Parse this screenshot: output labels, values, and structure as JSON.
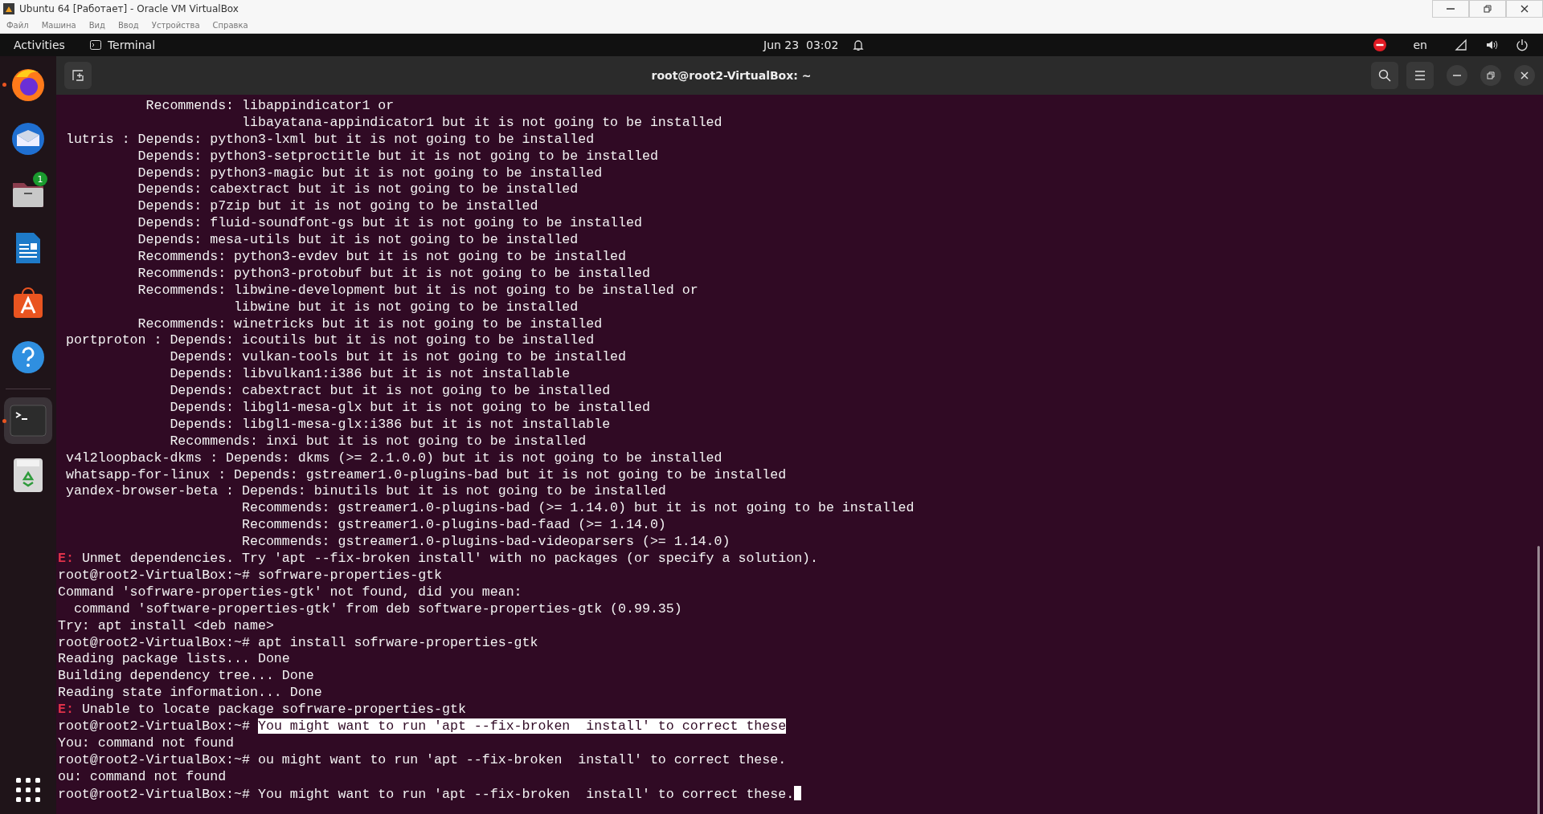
{
  "host_window": {
    "title": "Ubuntu 64 [Работает] - Oracle VM VirtualBox",
    "menu": [
      "Файл",
      "Машина",
      "Вид",
      "Ввод",
      "Устройства",
      "Справка"
    ]
  },
  "top_bar": {
    "activities": "Activities",
    "app": "Terminal",
    "clock": "Jun 23  03:02",
    "keyboard_layout": "en"
  },
  "dock": [
    {
      "kind": "firefox",
      "running": true,
      "selected": false
    },
    {
      "kind": "mail",
      "running": false,
      "selected": false
    },
    {
      "kind": "files",
      "running": false,
      "selected": false,
      "badge": "1"
    },
    {
      "kind": "writer",
      "running": false,
      "selected": false
    },
    {
      "kind": "store",
      "running": false,
      "selected": false
    },
    {
      "kind": "help",
      "running": false,
      "selected": false
    },
    {
      "kind": "terminal",
      "running": true,
      "selected": true
    },
    {
      "kind": "trash",
      "running": false,
      "selected": false
    }
  ],
  "terminal": {
    "title": "root@root2-VirtualBox: ~",
    "lines": [
      {
        "kind": "plain",
        "text": "           Recommends: libappindicator1 or"
      },
      {
        "kind": "plain",
        "text": "                       libayatana-appindicator1 but it is not going to be installed"
      },
      {
        "kind": "plain",
        "text": " lutris : Depends: python3-lxml but it is not going to be installed"
      },
      {
        "kind": "plain",
        "text": "          Depends: python3-setproctitle but it is not going to be installed"
      },
      {
        "kind": "plain",
        "text": "          Depends: python3-magic but it is not going to be installed"
      },
      {
        "kind": "plain",
        "text": "          Depends: cabextract but it is not going to be installed"
      },
      {
        "kind": "plain",
        "text": "          Depends: p7zip but it is not going to be installed"
      },
      {
        "kind": "plain",
        "text": "          Depends: fluid-soundfont-gs but it is not going to be installed"
      },
      {
        "kind": "plain",
        "text": "          Depends: mesa-utils but it is not going to be installed"
      },
      {
        "kind": "plain",
        "text": "          Recommends: python3-evdev but it is not going to be installed"
      },
      {
        "kind": "plain",
        "text": "          Recommends: python3-protobuf but it is not going to be installed"
      },
      {
        "kind": "plain",
        "text": "          Recommends: libwine-development but it is not going to be installed or"
      },
      {
        "kind": "plain",
        "text": "                      libwine but it is not going to be installed"
      },
      {
        "kind": "plain",
        "text": "          Recommends: winetricks but it is not going to be installed"
      },
      {
        "kind": "plain",
        "text": " portproton : Depends: icoutils but it is not going to be installed"
      },
      {
        "kind": "plain",
        "text": "              Depends: vulkan-tools but it is not going to be installed"
      },
      {
        "kind": "plain",
        "text": "              Depends: libvulkan1:i386 but it is not installable"
      },
      {
        "kind": "plain",
        "text": "              Depends: cabextract but it is not going to be installed"
      },
      {
        "kind": "plain",
        "text": "              Depends: libgl1-mesa-glx but it is not going to be installed"
      },
      {
        "kind": "plain",
        "text": "              Depends: libgl1-mesa-glx:i386 but it is not installable"
      },
      {
        "kind": "plain",
        "text": "              Recommends: inxi but it is not going to be installed"
      },
      {
        "kind": "plain",
        "text": " v4l2loopback-dkms : Depends: dkms (>= 2.1.0.0) but it is not going to be installed"
      },
      {
        "kind": "plain",
        "text": " whatsapp-for-linux : Depends: gstreamer1.0-plugins-bad but it is not going to be installed"
      },
      {
        "kind": "plain",
        "text": " yandex-browser-beta : Depends: binutils but it is not going to be installed"
      },
      {
        "kind": "plain",
        "text": "                       Recommends: gstreamer1.0-plugins-bad (>= 1.14.0) but it is not going to be installed"
      },
      {
        "kind": "plain",
        "text": "                       Recommends: gstreamer1.0-plugins-bad-faad (>= 1.14.0)"
      },
      {
        "kind": "plain",
        "text": "                       Recommends: gstreamer1.0-plugins-bad-videoparsers (>= 1.14.0)"
      },
      {
        "kind": "error",
        "mark": "E:",
        "text": "Unmet dependencies. Try 'apt --fix-broken install' with no packages (or specify a solution)."
      },
      {
        "kind": "prompt",
        "prompt": "root@root2-VirtualBox:~#",
        "command": "sofrware-properties-gtk",
        "highlighted": false
      },
      {
        "kind": "plain",
        "text": "Command 'sofrware-properties-gtk' not found, did you mean:"
      },
      {
        "kind": "plain",
        "text": "  command 'software-properties-gtk' from deb software-properties-gtk (0.99.35)"
      },
      {
        "kind": "plain",
        "text": "Try: apt install <deb name>"
      },
      {
        "kind": "prompt",
        "prompt": "root@root2-VirtualBox:~#",
        "command": "apt install sofrware-properties-gtk",
        "highlighted": false
      },
      {
        "kind": "plain",
        "text": "Reading package lists... Done"
      },
      {
        "kind": "plain",
        "text": "Building dependency tree... Done"
      },
      {
        "kind": "plain",
        "text": "Reading state information... Done"
      },
      {
        "kind": "error",
        "mark": "E:",
        "text": "Unable to locate package sofrware-properties-gtk"
      },
      {
        "kind": "prompt",
        "prompt": "root@root2-VirtualBox:~#",
        "command": "You might want to run 'apt --fix-broken  install' to correct these",
        "highlighted": true
      },
      {
        "kind": "plain",
        "text": "You: command not found"
      },
      {
        "kind": "prompt",
        "prompt": "root@root2-VirtualBox:~#",
        "command": "ou might want to run 'apt --fix-broken  install' to correct these.",
        "highlighted": false
      },
      {
        "kind": "plain",
        "text": "ou: command not found"
      },
      {
        "kind": "prompt",
        "prompt": "root@root2-VirtualBox:~#",
        "command": "You might want to run 'apt --fix-broken  install' to correct these.",
        "highlighted": false,
        "cursor": true
      }
    ]
  }
}
